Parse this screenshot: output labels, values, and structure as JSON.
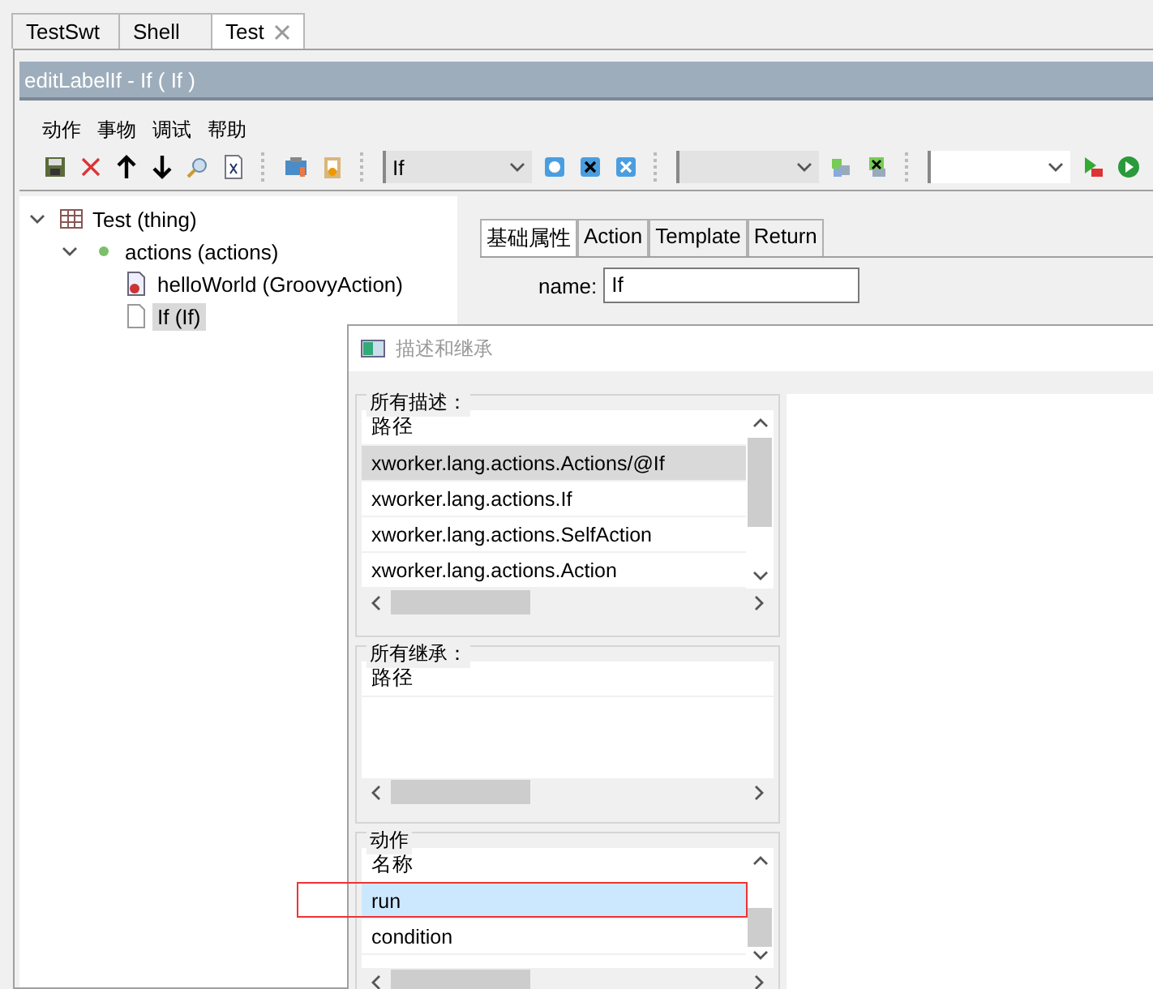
{
  "editor_tabs": [
    {
      "label": "TestSwt",
      "selected": false,
      "closable": false
    },
    {
      "label": "Shell",
      "selected": false,
      "closable": false
    },
    {
      "label": "Test",
      "selected": true,
      "closable": true
    }
  ],
  "view_title": "editLabelIf - If ( If )",
  "menu": [
    "动作",
    "事物",
    "调试",
    "帮助"
  ],
  "toolbar": {
    "action_combo": {
      "value": "If",
      "disabled": true
    },
    "second_combo": {
      "disabled": true
    },
    "third_combo": {
      "disabled": false
    }
  },
  "tree": [
    {
      "label": "Test (thing)",
      "kind": "thing",
      "expanded": true,
      "selected": false,
      "children": [
        {
          "label": "actions (actions)",
          "kind": "folder",
          "expanded": true,
          "selected": false,
          "children": [
            {
              "label": "helloWorld (GroovyAction)",
              "kind": "script",
              "selected": false
            },
            {
              "label": "If (If)",
              "kind": "file",
              "selected": true
            }
          ]
        }
      ]
    }
  ],
  "property_tabs": [
    {
      "label": "基础属性",
      "selected": true
    },
    {
      "label": "Action",
      "selected": false
    },
    {
      "label": "Template",
      "selected": false
    },
    {
      "label": "Return",
      "selected": false
    }
  ],
  "fields": [
    {
      "label": "name:",
      "value": "If"
    }
  ],
  "dialog": {
    "title": "描述和继承",
    "groups": [
      {
        "title": "所有描述：",
        "header": "路径",
        "focused": false,
        "rows": [
          {
            "text": "xworker.lang.actions.Actions/@If",
            "selected": true
          },
          {
            "text": "xworker.lang.actions.If",
            "selected": false
          },
          {
            "text": "xworker.lang.actions.SelfAction",
            "selected": false
          },
          {
            "text": "xworker.lang.actions.Action",
            "selected": false
          }
        ]
      },
      {
        "title": "所有继承：",
        "header": "路径"
      },
      {
        "title": "动作",
        "header": "名称",
        "focused": true,
        "rows": [
          {
            "text": "run",
            "selected": true
          },
          {
            "text": "condition",
            "selected": false
          }
        ]
      }
    ]
  }
}
